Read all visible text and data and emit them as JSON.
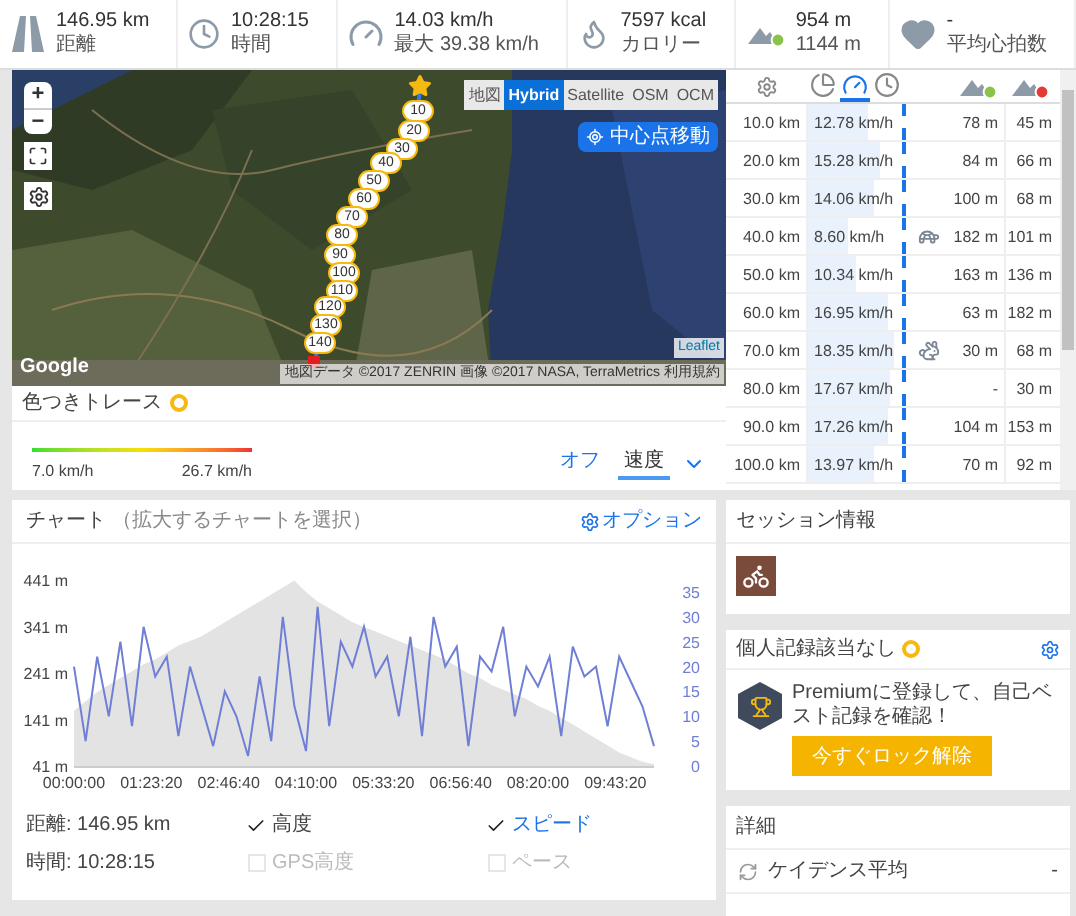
{
  "stats": [
    {
      "kind": "distance",
      "value": "146.95 km",
      "label": "距離"
    },
    {
      "kind": "time",
      "value": "10:28:15",
      "label": "時間"
    },
    {
      "kind": "speed",
      "value": "14.03 km/h",
      "label": "最大 39.38 km/h"
    },
    {
      "kind": "calories",
      "value": "7597 kcal",
      "label": "カロリー"
    },
    {
      "kind": "elevation",
      "value": "954 m",
      "label": "1144 m"
    },
    {
      "kind": "heart",
      "value": "-",
      "label": "平均心拍数"
    }
  ],
  "map": {
    "layers": [
      {
        "label": "地図",
        "selected": false
      },
      {
        "label": "Hybrid",
        "selected": true
      },
      {
        "label": "Satellite",
        "selected": false
      },
      {
        "label": "OSM",
        "selected": false
      },
      {
        "label": "OCM",
        "selected": false
      }
    ],
    "center_button": "中心点移動",
    "zoom_in": "+",
    "zoom_out": "−",
    "markers": [
      "10",
      "20",
      "30",
      "40",
      "50",
      "60",
      "70",
      "80",
      "90",
      "100",
      "110",
      "120",
      "130",
      "140"
    ],
    "logo": "Google",
    "attribution": "地図データ ©2017 ZENRIN 画像 ©2017 NASA, TerraMetrics",
    "terms": "利用規約",
    "credit": "Leaflet"
  },
  "color_trace": {
    "title": "色つきトレース",
    "min": "7.0 km/h",
    "max": "26.7 km/h",
    "options": [
      {
        "label": "オフ",
        "selected": false
      },
      {
        "label": "速度",
        "selected": true
      }
    ]
  },
  "splits": {
    "tabs": [
      {
        "kind": "pie",
        "selected": false
      },
      {
        "kind": "speed",
        "selected": true
      },
      {
        "kind": "time",
        "selected": false
      }
    ],
    "rows": [
      {
        "distance": "10.0 km",
        "speed": "12.78 km/h",
        "level": 0.64,
        "kind": "plain",
        "ascent": "78 m",
        "descent": "45 m"
      },
      {
        "distance": "20.0 km",
        "speed": "15.28 km/h",
        "level": 0.76,
        "kind": "plain",
        "ascent": "84 m",
        "descent": "66 m"
      },
      {
        "distance": "30.0 km",
        "speed": "14.06 km/h",
        "level": 0.7,
        "kind": "plain",
        "ascent": "100 m",
        "descent": "68 m"
      },
      {
        "distance": "40.0 km",
        "speed": "8.60 km/h",
        "level": 0.43,
        "kind": "slowest",
        "ascent": "182 m",
        "descent": "101 m"
      },
      {
        "distance": "50.0 km",
        "speed": "10.34 km/h",
        "level": 0.52,
        "kind": "plain",
        "ascent": "163 m",
        "descent": "136 m"
      },
      {
        "distance": "60.0 km",
        "speed": "16.95 km/h",
        "level": 0.85,
        "kind": "plain",
        "ascent": "63 m",
        "descent": "182 m"
      },
      {
        "distance": "70.0 km",
        "speed": "18.35 km/h",
        "level": 0.92,
        "kind": "fastest",
        "ascent": "30 m",
        "descent": "68 m"
      },
      {
        "distance": "80.0 km",
        "speed": "17.67 km/h",
        "level": 0.88,
        "kind": "plain",
        "ascent": "-",
        "descent": "30 m"
      },
      {
        "distance": "90.0 km",
        "speed": "17.26 km/h",
        "level": 0.86,
        "kind": "plain",
        "ascent": "104 m",
        "descent": "153 m"
      },
      {
        "distance": "100.0 km",
        "speed": "13.97 km/h",
        "level": 0.7,
        "kind": "plain",
        "ascent": "70 m",
        "descent": "92 m"
      }
    ]
  },
  "chart": {
    "title": "チャート",
    "hint": "（拡大するチャートを選択）",
    "options_link": "オプション",
    "chart_data": {
      "type": "area",
      "x": [
        0,
        750,
        1500,
        2250,
        3000,
        3750,
        4500,
        5250,
        6000,
        6750,
        7500,
        8250,
        9000,
        9750,
        10500,
        11250,
        12000,
        12750,
        13500,
        14250,
        15000,
        15750,
        16500,
        17250,
        18000,
        18750,
        19500,
        20250,
        21000,
        21750,
        22500,
        23250,
        24000,
        24750,
        25500,
        26250,
        27000,
        27750,
        28500,
        29250,
        30000,
        30750,
        31500,
        32250,
        33000,
        33750,
        34500,
        35250,
        36000,
        36750,
        37500
      ],
      "series": [
        {
          "name": "高度",
          "type": "area",
          "color": "#e3e3e3",
          "values": [
            160,
            180,
            200,
            215,
            230,
            245,
            260,
            270,
            285,
            300,
            310,
            320,
            335,
            350,
            365,
            380,
            395,
            410,
            425,
            440,
            415,
            395,
            380,
            365,
            350,
            340,
            330,
            320,
            310,
            300,
            290,
            280,
            270,
            255,
            240,
            230,
            215,
            205,
            195,
            185,
            170,
            160,
            145,
            130,
            115,
            100,
            85,
            70,
            60,
            50,
            45
          ]
        },
        {
          "name": "スピード",
          "type": "line",
          "color": "#6f7fd6",
          "axis": "y2",
          "values": [
            20,
            5,
            22,
            10,
            25,
            8,
            28,
            18,
            22,
            6,
            20,
            12,
            4,
            15,
            10,
            2,
            18,
            5,
            30,
            12,
            3,
            32,
            8,
            25,
            20,
            28,
            18,
            22,
            10,
            26,
            6,
            30,
            20,
            24,
            4,
            22,
            19,
            28,
            10,
            20,
            16,
            22,
            6,
            24,
            18,
            20,
            8,
            22,
            17,
            12,
            4
          ]
        }
      ],
      "xlim": [
        0,
        37500
      ],
      "ylim": [
        41,
        441
      ],
      "y2lim": [
        0,
        35
      ],
      "xticks": [
        {
          "value": 0,
          "label": "00:00:00"
        },
        {
          "value": 5000,
          "label": "01:23:20"
        },
        {
          "value": 10000,
          "label": "02:46:40"
        },
        {
          "value": 15000,
          "label": "04:10:00"
        },
        {
          "value": 20000,
          "label": "05:33:20"
        },
        {
          "value": 25000,
          "label": "06:56:40"
        },
        {
          "value": 30000,
          "label": "08:20:00"
        },
        {
          "value": 35000,
          "label": "09:43:20"
        }
      ],
      "yticks": [
        {
          "value": 41,
          "label": "41 m"
        },
        {
          "value": 141,
          "label": "141 m"
        },
        {
          "value": 241,
          "label": "241 m"
        },
        {
          "value": 341,
          "label": "341 m"
        },
        {
          "value": 441,
          "label": "441 m"
        }
      ],
      "y2ticks": [
        0,
        5,
        10,
        15,
        20,
        25,
        30,
        35
      ]
    },
    "summary": [
      "距離: 146.95 km",
      "時間: 10:28:15"
    ],
    "series_options": [
      {
        "kind": "series",
        "checked": true
      },
      {
        "kind": "extra",
        "label": "GPS高度",
        "checked": false
      },
      {
        "kind": "series",
        "checked": true
      },
      {
        "kind": "extra",
        "label": "ペース",
        "checked": false
      }
    ]
  },
  "session": {
    "title": "セッション情報"
  },
  "records": {
    "title": "個人記録該当なし",
    "message": "Premiumに登録して、自己ベスト記録を確認！",
    "button": "今すぐロック解除"
  },
  "details": {
    "title": "詳細",
    "rows": [
      {
        "label": "ケイデンス平均",
        "value": "-"
      }
    ]
  }
}
